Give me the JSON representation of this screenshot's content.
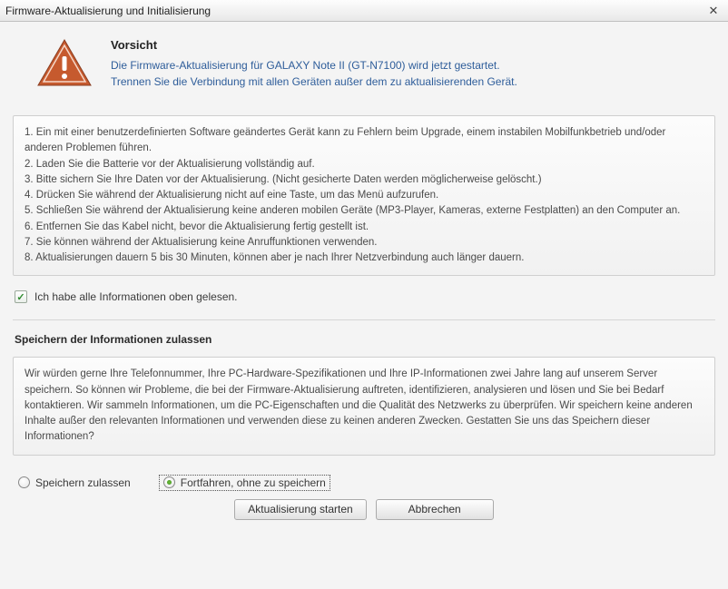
{
  "window": {
    "title": "Firmware-Aktualisierung und Initialisierung"
  },
  "header": {
    "caution_title": "Vorsicht",
    "line1": "Die Firmware-Aktualisierung für GALAXY Note II  (GT-N7100) wird jetzt gestartet.",
    "line2": "Trennen Sie die Verbindung mit allen Geräten außer dem zu aktualisierenden Gerät."
  },
  "info": {
    "i1": "1. Ein mit einer benutzerdefinierten Software geändertes Gerät kann zu Fehlern beim Upgrade, einem instabilen Mobilfunkbetrieb und/oder anderen Problemen führen.",
    "i2": "2. Laden Sie die Batterie vor der Aktualisierung vollständig auf.",
    "i3": "3. Bitte sichern Sie Ihre Daten vor der Aktualisierung. (Nicht gesicherte Daten werden möglicherweise gelöscht.)",
    "i4": "4. Drücken Sie während der Aktualisierung nicht auf eine Taste, um das Menü aufzurufen.",
    "i5": "5. Schließen Sie während der Aktualisierung keine anderen mobilen Geräte (MP3-Player, Kameras, externe Festplatten) an den Computer an.",
    "i6": "6. Entfernen Sie das Kabel nicht, bevor die Aktualisierung fertig gestellt ist.",
    "i7": "7. Sie können während der Aktualisierung keine Anruffunktionen verwenden.",
    "i8": "8. Aktualisierungen dauern 5 bis 30 Minuten, können aber je nach Ihrer Netzverbindung auch länger dauern."
  },
  "confirm": {
    "label": "Ich habe alle Informationen oben gelesen."
  },
  "storage": {
    "title": "Speichern der Informationen zulassen",
    "body": "Wir würden gerne Ihre Telefonnummer, Ihre PC-Hardware-Spezifikationen und Ihre IP-Informationen zwei Jahre lang auf unserem Server speichern. So können wir Probleme, die bei der Firmware-Aktualisierung auftreten, identifizieren, analysieren und lösen und Sie bei Bedarf kontaktieren. Wir sammeln Informationen, um die PC-Eigenschaften und die Qualität des Netzwerks zu überprüfen. Wir speichern keine anderen Inhalte außer den relevanten Informationen und verwenden diese zu keinen anderen Zwecken. Gestatten Sie uns das Speichern dieser Informationen?",
    "option_allow": "Speichern zulassen",
    "option_deny": "Fortfahren, ohne zu speichern"
  },
  "buttons": {
    "start": "Aktualisierung starten",
    "cancel": "Abbrechen"
  },
  "colors": {
    "link": "#2e5d9a",
    "warn_fill": "#c65a2e",
    "accent_green": "#3d8f1d"
  }
}
